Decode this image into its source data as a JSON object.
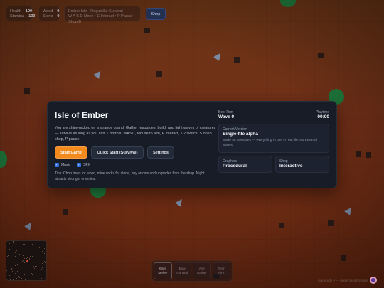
{
  "hud": {
    "stats": [
      {
        "label": "Health",
        "value": "100"
      },
      {
        "label": "Stamina",
        "value": "100"
      }
    ],
    "resources": [
      {
        "label": "Wood",
        "value": "0"
      },
      {
        "label": "Stone",
        "value": "0"
      }
    ],
    "message_line1": "Ember Isle - Roguelike Survival",
    "message_line2": "W A S D Move • E Interact • P Pause • Shop B",
    "shop_label": "Shop"
  },
  "menu": {
    "title": "Isle of Ember",
    "description": "You are shipwrecked on a strange island. Gather resources, build, and fight waves of creatures — survive as long as you can. Controls: WASD, Mouse to aim, E interact, 1/2 switch, S open shop, P pause.",
    "buttons": {
      "start": "Start Game",
      "quick_start": "Quick Start (Survival)",
      "settings": "Settings"
    },
    "toggles": {
      "music": "Music",
      "sfx": "SFX"
    },
    "tips": "Tips: Chop trees for wood, mine rocks for stone, buy arrows and upgrades from the shop. Night attracts stronger enemies.",
    "best_run": {
      "label": "Best Run",
      "value": "Wave 0"
    },
    "playtime": {
      "label": "Playtime",
      "value": "00:00"
    },
    "version": {
      "label": "Current Version",
      "value": "Single-file alpha",
      "note": "Made for Neocities — everything in one HTML file. No external assets."
    },
    "graphics": {
      "label": "Graphics",
      "value": "Procedural"
    },
    "shop": {
      "label": "Shop",
      "value": "Interactive"
    }
  },
  "hotbar": [
    {
      "key": "1",
      "name": "Knife",
      "sub": "Melee"
    },
    {
      "key": "2",
      "name": "Bow",
      "sub": "Ranged"
    },
    {
      "key": "3",
      "name": "Axe",
      "sub": "Gather"
    },
    {
      "key": "4",
      "name": "Torch",
      "sub": "Fire"
    }
  ],
  "credit": "made with ♥ — single file adventure",
  "colors": {
    "accent": "#f28a1e",
    "panel": "#171c27",
    "ground": "#6b3516",
    "bush": "#1f7a3c",
    "checkbox": "#2f6fde"
  }
}
